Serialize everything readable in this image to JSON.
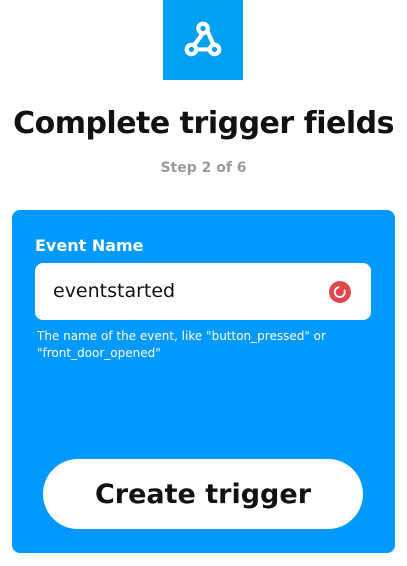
{
  "colors": {
    "brand": "#00a0f0",
    "card": "#0099ff",
    "status_icon": "#e0484f"
  },
  "logo": {
    "icon": "webhooks-icon"
  },
  "header": {
    "title": "Complete trigger fields",
    "step": "Step 2 of 6"
  },
  "form": {
    "event_name": {
      "label": "Event Name",
      "value": "eventstarted",
      "status_icon": "loading-spinner-icon",
      "help": "The name of the event, like \"button_pressed\" or \"front_door_opened\""
    },
    "submit_label": "Create trigger"
  }
}
